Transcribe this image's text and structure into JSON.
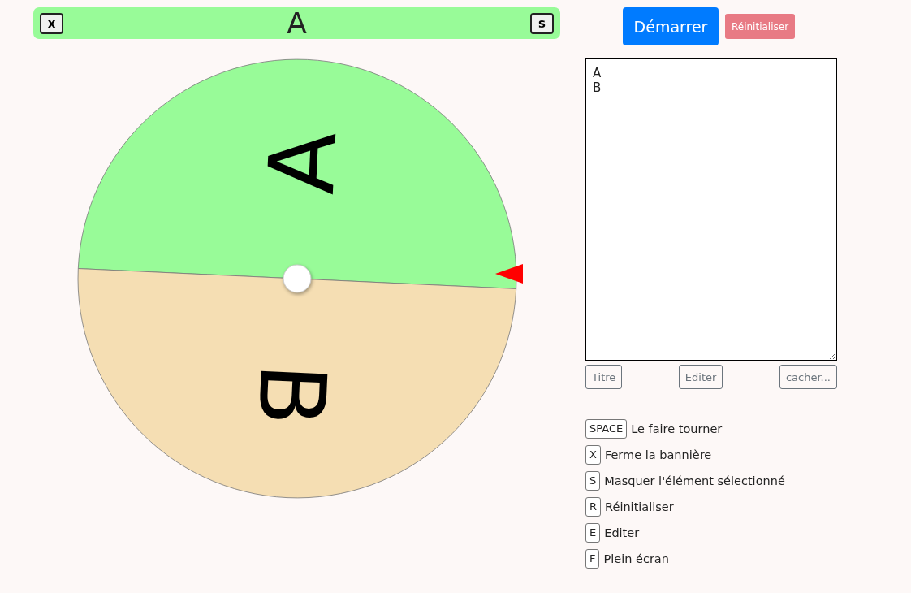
{
  "banner": {
    "close_key": "x",
    "hide_key": "s",
    "title": "A"
  },
  "wheel": {
    "segments": [
      {
        "label": "A",
        "color": "#98fb98"
      },
      {
        "label": "B",
        "color": "#f5deb3"
      }
    ]
  },
  "buttons": {
    "start": "Démarrer",
    "reset": "Réinitialiser"
  },
  "entries": {
    "value": "A\nB"
  },
  "entry_buttons": [
    "Titre",
    "Editer",
    "cacher..."
  ],
  "shortcuts": [
    {
      "key": "SPACE",
      "label": "Le faire tourner"
    },
    {
      "key": "X",
      "label": "Ferme la bannière"
    },
    {
      "key": "S",
      "label": "Masquer l'élément sélectionné"
    },
    {
      "key": "R",
      "label": "Réinitialiser"
    },
    {
      "key": "E",
      "label": "Editer"
    },
    {
      "key": "F",
      "label": "Plein écran"
    }
  ]
}
